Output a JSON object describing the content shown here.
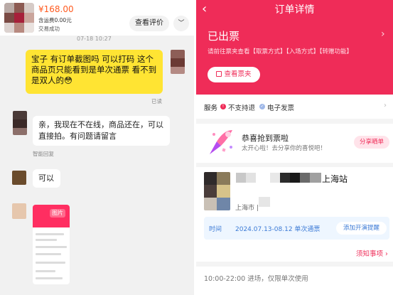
{
  "chat": {
    "order": {
      "price": "¥168.00",
      "shipping": "含运费0.00元",
      "status": "交易成功",
      "review_label": "查看评价",
      "more_label": "﹀"
    },
    "timestamp": "07-18 10:27",
    "messages": [
      {
        "text": "宝子 有订单截图吗 可以打码 这个商品页只能看到是单次通票 看不到是双人的😳",
        "note": "已读"
      },
      {
        "text": "亲，我现在不在线，商品还在，可以直接拍。有问题请留言",
        "note": "智能回复"
      },
      {
        "text": "可以"
      }
    ],
    "image_tag": "图片"
  },
  "order_detail": {
    "back_icon": "‹",
    "title": "订单详情",
    "status": "已出票",
    "status_chevron": "›",
    "hint": "请前往票夹查看【取票方式】【入场方式】【转赠功能】",
    "ticket_button": "查看票夹",
    "service": {
      "label": "服务",
      "item1": "不支持退",
      "item2": "电子发票",
      "chevron": "›"
    },
    "congrats": {
      "title": "恭喜抢到票啦",
      "subtitle": "太开心啦！去分享你的喜悦吧！",
      "share_button": "分享晒单"
    },
    "show": {
      "venue": "上海站",
      "city": "上海市 |",
      "time_label": "时间",
      "time_value": "2024.07.13-08.12 单次通票",
      "remind_button": "添加开演提醒"
    },
    "notice": "须知事项 ›",
    "entry_time": "10:00-22:00 进场，仅限单次使用"
  },
  "colors": {
    "accent": "#ef2c58",
    "chat_bubble": "#ffe433",
    "price": "#ff5a1f",
    "info_blue": "#3d7bd6"
  }
}
